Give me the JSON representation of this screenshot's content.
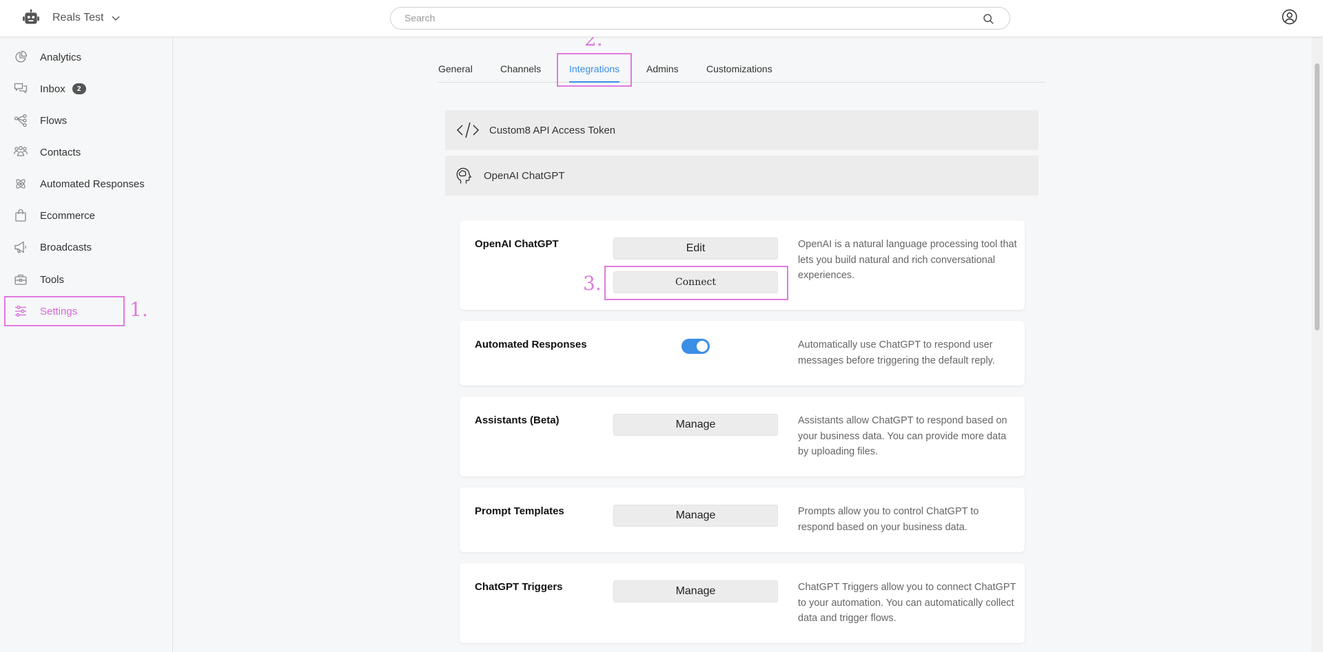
{
  "header": {
    "workspace_name": "Reals Test",
    "search_placeholder": "Search"
  },
  "sidebar": {
    "items": [
      {
        "label": "Analytics",
        "icon": "pie-chart-icon"
      },
      {
        "label": "Inbox",
        "icon": "chat-icon",
        "badge": "2"
      },
      {
        "label": "Flows",
        "icon": "flows-icon"
      },
      {
        "label": "Contacts",
        "icon": "contacts-icon"
      },
      {
        "label": "Automated Responses",
        "icon": "atom-icon"
      },
      {
        "label": "Ecommerce",
        "icon": "shopping-bag-icon"
      },
      {
        "label": "Broadcasts",
        "icon": "megaphone-icon"
      },
      {
        "label": "Tools",
        "icon": "toolbox-icon"
      },
      {
        "label": "Settings",
        "icon": "sliders-icon",
        "active": true
      }
    ]
  },
  "tabs": [
    {
      "label": "General"
    },
    {
      "label": "Channels"
    },
    {
      "label": "Integrations",
      "active": true
    },
    {
      "label": "Admins"
    },
    {
      "label": "Customizations"
    }
  ],
  "integrations": [
    {
      "label": "Custom8 API Access Token",
      "icon": "code-icon"
    },
    {
      "label": "OpenAI ChatGPT",
      "icon": "brain-head-icon"
    }
  ],
  "cards": {
    "openai": {
      "title": "OpenAI ChatGPT",
      "edit_label": "Edit",
      "connect_label": "Connect",
      "description": "OpenAI is a natural language processing tool that lets you build natural and rich conversational experiences."
    },
    "automated": {
      "title": "Automated Responses",
      "toggle_on": true,
      "description": "Automatically use ChatGPT to respond user messages before triggering the default reply."
    },
    "assistants": {
      "title": "Assistants (Beta)",
      "button_label": "Manage",
      "description": "Assistants allow ChatGPT to respond based on your business data. You can provide more data by uploading files."
    },
    "prompts": {
      "title": "Prompt Templates",
      "button_label": "Manage",
      "description": "Prompts allow you to control ChatGPT to respond based on your business data."
    },
    "triggers": {
      "title": "ChatGPT Triggers",
      "button_label": "Manage",
      "description": "ChatGPT Triggers allow you to connect ChatGPT to your automation. You can automatically collect data and trigger flows."
    }
  },
  "annotations": {
    "step1": "1.",
    "step2": "2.",
    "step3": "3.",
    "color": "#e07ae0"
  },
  "colors": {
    "accent": "#3a8ee6",
    "active_nav": "#d667d6"
  }
}
